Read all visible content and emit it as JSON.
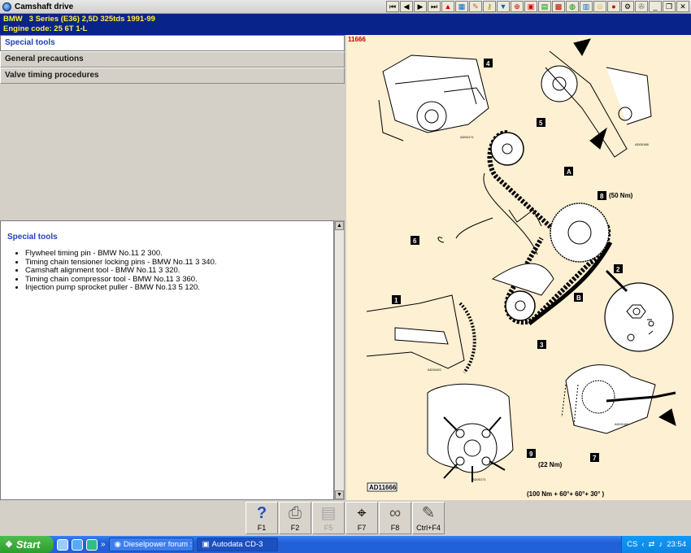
{
  "window": {
    "title": "Camshaft drive",
    "toolbar_icons": [
      "first-page-icon",
      "previous-page-icon",
      "next-page-icon",
      "last-page-icon",
      "warning-icon",
      "diagram-icon",
      "paint-icon",
      "key-icon",
      "filter-icon",
      "measure-icon",
      "toolbox-icon",
      "book-icon",
      "engine-icon",
      "light-icon",
      "chart-icon",
      "smiley-icon",
      "circle-icon",
      "gear-icon",
      "wrench-icon",
      "minimize-icon",
      "restore-icon",
      "close-icon"
    ]
  },
  "vehicle": {
    "line1": "BMW   3 Series (E36) 2,5D 325tds 1991-99",
    "line2": "Engine code: 25 6T 1-L"
  },
  "nav": {
    "items": [
      {
        "label": "Special tools",
        "active": true
      },
      {
        "label": "General precautions",
        "active": false
      },
      {
        "label": "Valve timing procedures",
        "active": false
      }
    ]
  },
  "content": {
    "heading": "Special tools",
    "items": [
      "Flywheel timing pin - BMW No.11 2 300.",
      "Timing chain tensioner locking pins - BMW No.11 3 340.",
      "Camshaft alignment tool - BMW No.11 3 320.",
      "Timing chain compressor tool - BMW No.11 3 360.",
      "Injection pump sprocket puller - BMW No.13 5 120."
    ]
  },
  "diagram": {
    "id": "11666",
    "ref_code": "AD11666",
    "callouts": [
      "1",
      "2",
      "3",
      "4",
      "5",
      "6",
      "7",
      "8",
      "9",
      "A",
      "B"
    ],
    "torque_8": "(50 Nm)",
    "torque_9": "(22 Nm)",
    "torque_bottom": "(100 Nm + 60°+ 60°+ 30° )"
  },
  "fkeys": [
    {
      "icon": "help-icon",
      "label": "F1",
      "enabled": true
    },
    {
      "icon": "print-icon",
      "label": "F2",
      "enabled": true
    },
    {
      "icon": "book-icon",
      "label": "F5",
      "enabled": false
    },
    {
      "icon": "zoom-icon",
      "label": "F7",
      "enabled": true
    },
    {
      "icon": "chain-icon",
      "label": "F8",
      "enabled": true
    },
    {
      "icon": "notes-icon",
      "label": "Ctrl+F4",
      "enabled": true
    }
  ],
  "taskbar": {
    "start": "Start",
    "quicklaunch_more": "»",
    "tasks": [
      "Dieselpower forum :: ...",
      "Autodata CD-3"
    ],
    "lang": "CS",
    "clock": "23:54"
  }
}
